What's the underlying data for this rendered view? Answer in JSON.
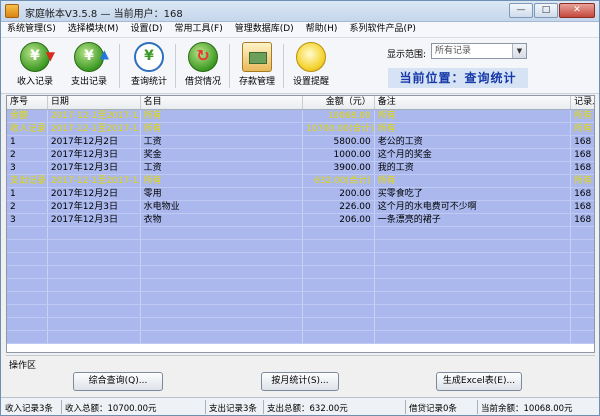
{
  "window": {
    "title": "家庭帐本V3.5.8  —  当前用户：168",
    "buttons": [
      "—",
      "□",
      "✕"
    ]
  },
  "menu": [
    "系统管理(S)",
    "选择模块(M)",
    "设置(D)",
    "常用工具(F)",
    "管理数据库(D)",
    "帮助(H)",
    "系列软件产品(P)"
  ],
  "toolbar": {
    "tools": [
      {
        "label": "收入记录",
        "icon": "income-yuan-icon"
      },
      {
        "label": "支出记录",
        "icon": "expense-yuan-icon"
      },
      {
        "label": "查询统计",
        "icon": "query-magnifier-icon"
      },
      {
        "label": "借贷情况",
        "icon": "loan-yuan-icon"
      },
      {
        "label": "存款管理",
        "icon": "deposit-icon"
      },
      {
        "label": "设置提醒",
        "icon": "lightbulb-icon"
      }
    ],
    "range_label": "显示范围:",
    "range_value": "所有记录",
    "location": "当前位置：查询统计"
  },
  "grid": {
    "columns": [
      "序号",
      "日期",
      "名目",
      "金额（元）",
      "备注",
      "记录人"
    ],
    "rows": [
      {
        "type": "summary",
        "cells": [
          "余额",
          "2017-12-1至2017-1...",
          "所有",
          "10068.00",
          "所有",
          "所有"
        ]
      },
      {
        "type": "summary",
        "cells": [
          "收入记录",
          "2017-12-1至2017-1...",
          "所有",
          "10700.00(合计)",
          "所有",
          "所有"
        ]
      },
      {
        "type": "detail",
        "cells": [
          "1",
          "2017年12月2日",
          "工资",
          "5800.00",
          "老公的工资",
          "168"
        ]
      },
      {
        "type": "detail",
        "cells": [
          "2",
          "2017年12月3日",
          "奖金",
          "1000.00",
          "这个月的奖金",
          "168"
        ]
      },
      {
        "type": "detail",
        "cells": [
          "3",
          "2017年12月3日",
          "工资",
          "3900.00",
          "我的工资",
          "168"
        ]
      },
      {
        "type": "summary",
        "cells": [
          "支出记录",
          "2017-12-1至2017-1...",
          "所有",
          "632.00(合计)",
          "所有",
          "所有"
        ]
      },
      {
        "type": "detail",
        "cells": [
          "1",
          "2017年12月2日",
          "零用",
          "200.00",
          "买零食吃了",
          "168"
        ]
      },
      {
        "type": "detail",
        "cells": [
          "2",
          "2017年12月3日",
          "水电物业",
          "226.00",
          "这个月的水电费可不少啊",
          "168"
        ]
      },
      {
        "type": "detail",
        "cells": [
          "3",
          "2017年12月3日",
          "衣物",
          "206.00",
          "一条漂亮的裙子",
          "168"
        ]
      },
      {
        "type": "empty",
        "cells": [
          "",
          "",
          "",
          "",
          "",
          ""
        ]
      },
      {
        "type": "empty",
        "cells": [
          "",
          "",
          "",
          "",
          "",
          ""
        ]
      },
      {
        "type": "empty",
        "cells": [
          "",
          "",
          "",
          "",
          "",
          ""
        ]
      },
      {
        "type": "empty",
        "cells": [
          "",
          "",
          "",
          "",
          "",
          ""
        ]
      },
      {
        "type": "empty",
        "cells": [
          "",
          "",
          "",
          "",
          "",
          ""
        ]
      },
      {
        "type": "empty",
        "cells": [
          "",
          "",
          "",
          "",
          "",
          ""
        ]
      },
      {
        "type": "empty",
        "cells": [
          "",
          "",
          "",
          "",
          "",
          ""
        ]
      },
      {
        "type": "empty",
        "cells": [
          "",
          "",
          "",
          "",
          "",
          ""
        ]
      },
      {
        "type": "empty",
        "cells": [
          "",
          "",
          "",
          "",
          "",
          ""
        ]
      }
    ]
  },
  "ops": {
    "label": "操作区",
    "buttons": [
      "综合查询(Q)...",
      "按月统计(S)...",
      "生成Excel表(E)..."
    ]
  },
  "status": {
    "income_count": "收入记录3条",
    "income_total": "收入总额：10700.00元",
    "expense_count": "支出记录3条",
    "expense_total": "支出总额：632.00元",
    "loan_count": "借贷记录0条",
    "balance": "当前余额：10068.00元"
  },
  "colors": {
    "grid_row": "#aab8ee",
    "summary_text": "#e5d700",
    "location_text": "#1638a8"
  }
}
